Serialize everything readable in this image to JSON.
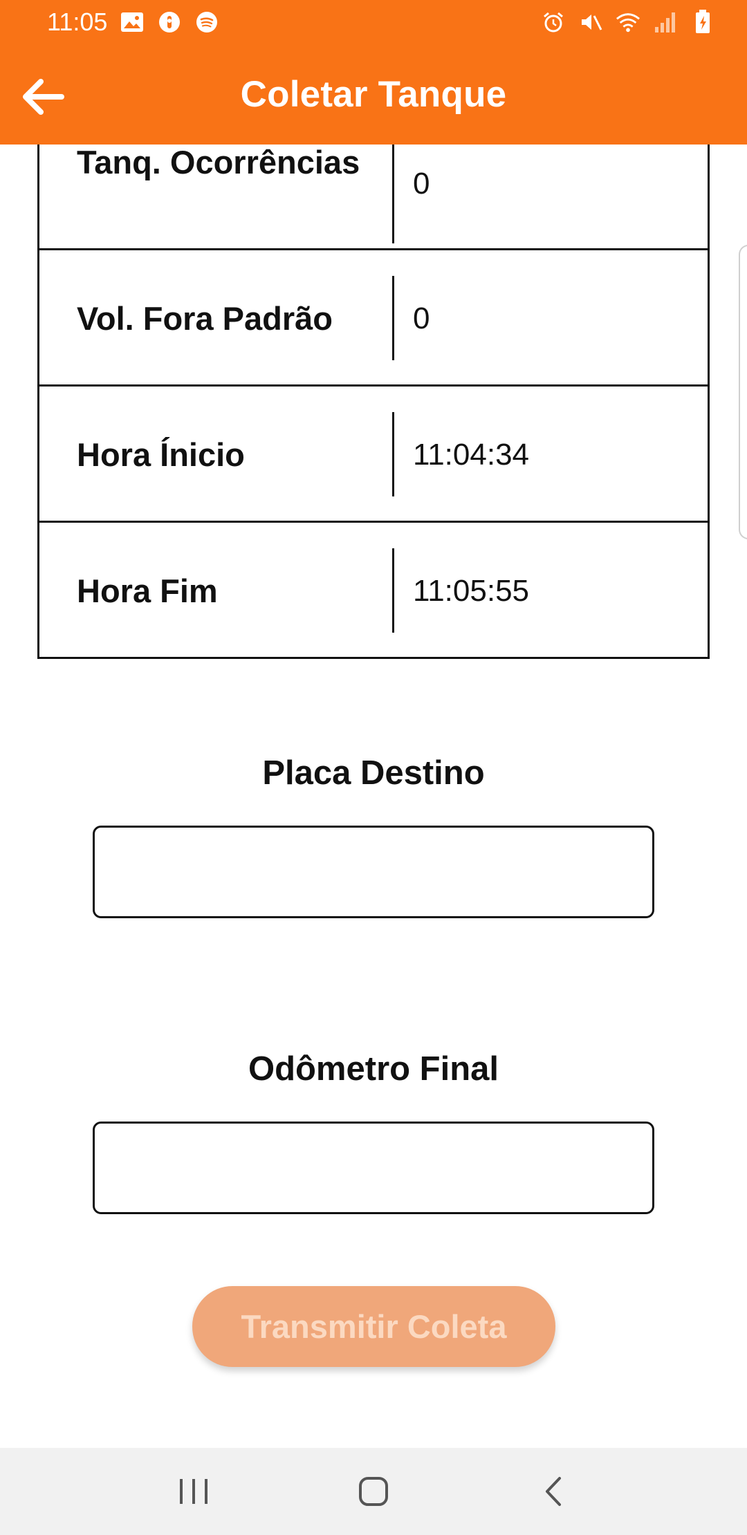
{
  "status_bar": {
    "time": "11:05",
    "left_icons": [
      "image-icon",
      "shield-icon",
      "spotify-icon"
    ],
    "right_icons": [
      "alarm-icon",
      "mute-icon",
      "wifi-icon",
      "signal-icon",
      "battery-icon"
    ]
  },
  "app_bar": {
    "title": "Coletar Tanque",
    "back_icon": "arrow-left-icon"
  },
  "info_table": {
    "rows": [
      {
        "label": "Tanq. Ocorrências",
        "value": "0"
      },
      {
        "label": "Vol. Fora Padrão",
        "value": "0"
      },
      {
        "label": "Hora Ínicio",
        "value": "11:04:34"
      },
      {
        "label": "Hora Fim",
        "value": "11:05:55"
      }
    ]
  },
  "form": {
    "placa_destino": {
      "label": "Placa Destino",
      "value": ""
    },
    "odometro_final": {
      "label": "Odômetro Final",
      "value": ""
    },
    "submit_label": "Transmitir Coleta"
  },
  "nav_bar": {
    "icons": [
      "recent-apps-icon",
      "home-icon",
      "back-icon"
    ]
  },
  "colors": {
    "primary": "#F97316",
    "button_disabled_bg": "#F0A77A",
    "button_disabled_text": "#FBD9C1"
  }
}
